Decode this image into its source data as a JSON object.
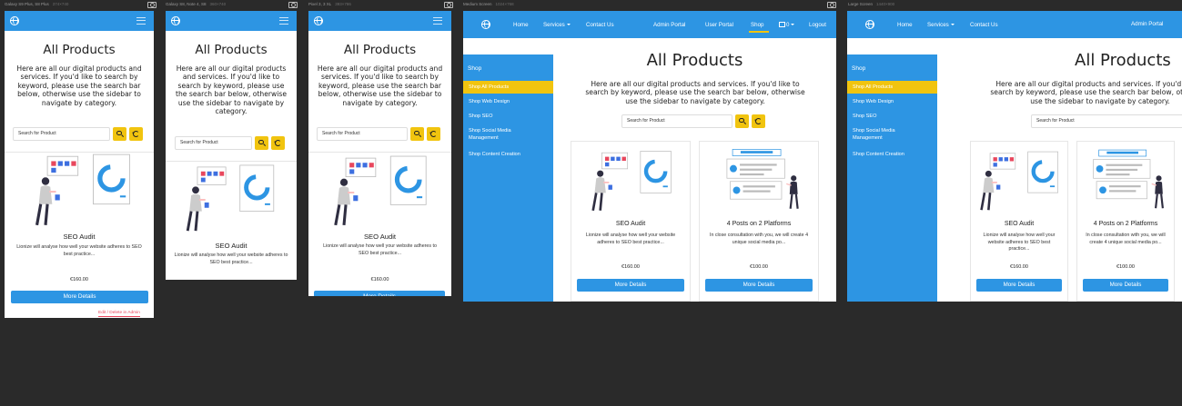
{
  "devices": [
    {
      "id": "d1",
      "name": "Galaxy S9 Plus, S8 Plus",
      "size": "374×740"
    },
    {
      "id": "d2",
      "name": "Galaxy S8, Note 4, S8",
      "size": "360×740"
    },
    {
      "id": "d3",
      "name": "Pixel 3, 3 XL",
      "size": "393×786"
    },
    {
      "id": "d4",
      "name": "Medium Screen",
      "size": "1024×768"
    },
    {
      "id": "d5",
      "name": "Large Screen",
      "size": "1440×900"
    }
  ],
  "page": {
    "title": "All Products",
    "intro": "Here are all our digital products and services. If you'd like to search by keyword, please use the search bar below, otherwise use the sidebar to navigate by category.",
    "search_placeholder": "Search for Product"
  },
  "nav": {
    "home": "Home",
    "services": "Services",
    "contact": "Contact Us",
    "admin_portal": "Admin Portal",
    "user_portal": "User Portal",
    "shop": "Shop",
    "cart_count": "0",
    "logout": "Logout"
  },
  "sidebar": {
    "heading": "Shop",
    "items": [
      {
        "label": "Shop All Products",
        "active": true
      },
      {
        "label": "Shop Web Design",
        "active": false
      },
      {
        "label": "Shop SEO",
        "active": false
      },
      {
        "label": "Shop Social Media Management",
        "active": false
      },
      {
        "label": "Shop Content Creation",
        "active": false
      }
    ]
  },
  "products": [
    {
      "title": "SEO Audit",
      "description": "Lionize will analyse how well your website adheres to SEO best practice...",
      "price": "€160.00",
      "button": "More Details",
      "illustration": "seo-illustration"
    },
    {
      "title": "4 Posts on 2 Platforms",
      "description": "In close consultation with you, we will create 4 unique social media po...",
      "price": "€100.00",
      "button": "More Details",
      "illustration": "social-illustration"
    }
  ],
  "large_product_2_description": "In close consultation with you, we will create 4 unique social media po...",
  "admin_link": "Edit / Delete in Admin",
  "colors": {
    "primary": "#2d95e3",
    "accent": "#f1c40f",
    "background": "#2a2a2a",
    "danger": "#e8475d"
  }
}
